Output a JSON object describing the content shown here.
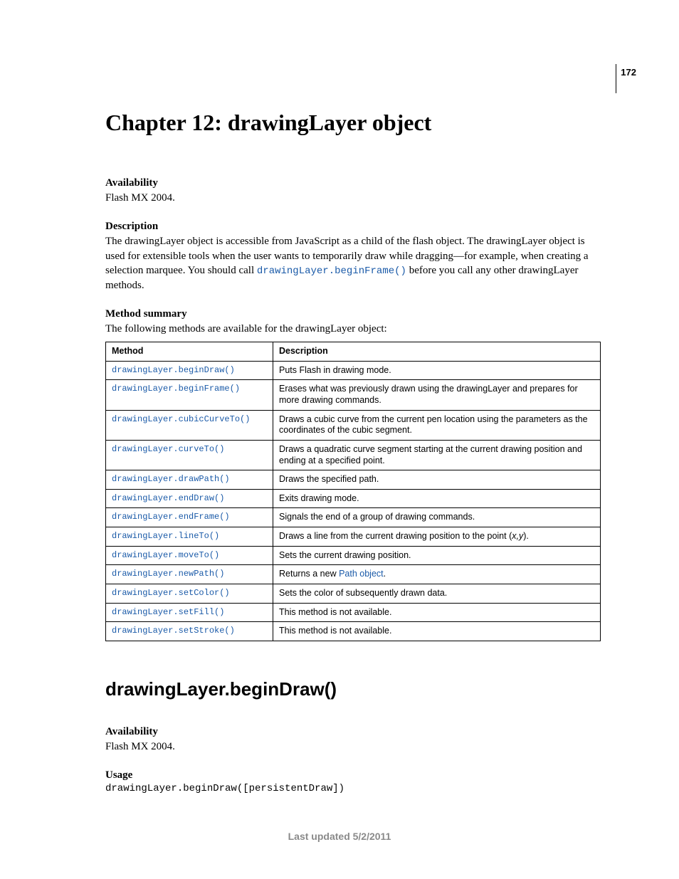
{
  "page_number": "172",
  "chapter_title": "Chapter 12: drawingLayer object",
  "sections": {
    "availability": {
      "label": "Availability",
      "text": "Flash MX 2004."
    },
    "description": {
      "label": "Description",
      "text_pre": "The drawingLayer object is accessible from JavaScript as a child of the flash object. The drawingLayer object is used for extensible tools when the user wants to temporarily draw while dragging—for example, when creating a selection marquee. You should call ",
      "code": "drawingLayer.beginFrame()",
      "text_post": " before you call any other drawingLayer methods."
    },
    "method_summary": {
      "label": "Method summary",
      "intro": "The following methods are available for the drawingLayer object:",
      "headers": {
        "method": "Method",
        "description": "Description"
      },
      "rows": [
        {
          "method": "drawingLayer.beginDraw()",
          "desc": "Puts Flash in drawing mode."
        },
        {
          "method": "drawingLayer.beginFrame()",
          "desc": "Erases what was previously drawn using the drawingLayer and prepares for more drawing commands."
        },
        {
          "method": "drawingLayer.cubicCurveTo()",
          "desc": "Draws a cubic curve from the current pen location using the parameters as the coordinates of the cubic segment."
        },
        {
          "method": "drawingLayer.curveTo()",
          "desc": "Draws a quadratic curve segment starting at the current drawing position and ending at a specified point."
        },
        {
          "method": "drawingLayer.drawPath()",
          "desc": "Draws the specified path."
        },
        {
          "method": "drawingLayer.endDraw()",
          "desc": "Exits drawing mode."
        },
        {
          "method": "drawingLayer.endFrame()",
          "desc": "Signals the end of a group of drawing commands."
        },
        {
          "method": "drawingLayer.lineTo()",
          "desc_pre": "Draws a line from the current drawing position to the point (",
          "desc_ital": "x,y",
          "desc_post": ")."
        },
        {
          "method": "drawingLayer.moveTo()",
          "desc": "Sets the current drawing position."
        },
        {
          "method": "drawingLayer.newPath()",
          "desc_pre": "Returns a new ",
          "desc_link": "Path object",
          "desc_post": "."
        },
        {
          "method": "drawingLayer.setColor()",
          "desc": "Sets the color of subsequently drawn data."
        },
        {
          "method": "drawingLayer.setFill()",
          "desc": "This method is not available."
        },
        {
          "method": "drawingLayer.setStroke()",
          "desc": "This method is not available."
        }
      ]
    }
  },
  "api": {
    "heading": "drawingLayer.beginDraw()",
    "availability": {
      "label": "Availability",
      "text": "Flash MX 2004."
    },
    "usage": {
      "label": "Usage",
      "code": "drawingLayer.beginDraw([persistentDraw])"
    }
  },
  "footer": "Last updated 5/2/2011"
}
